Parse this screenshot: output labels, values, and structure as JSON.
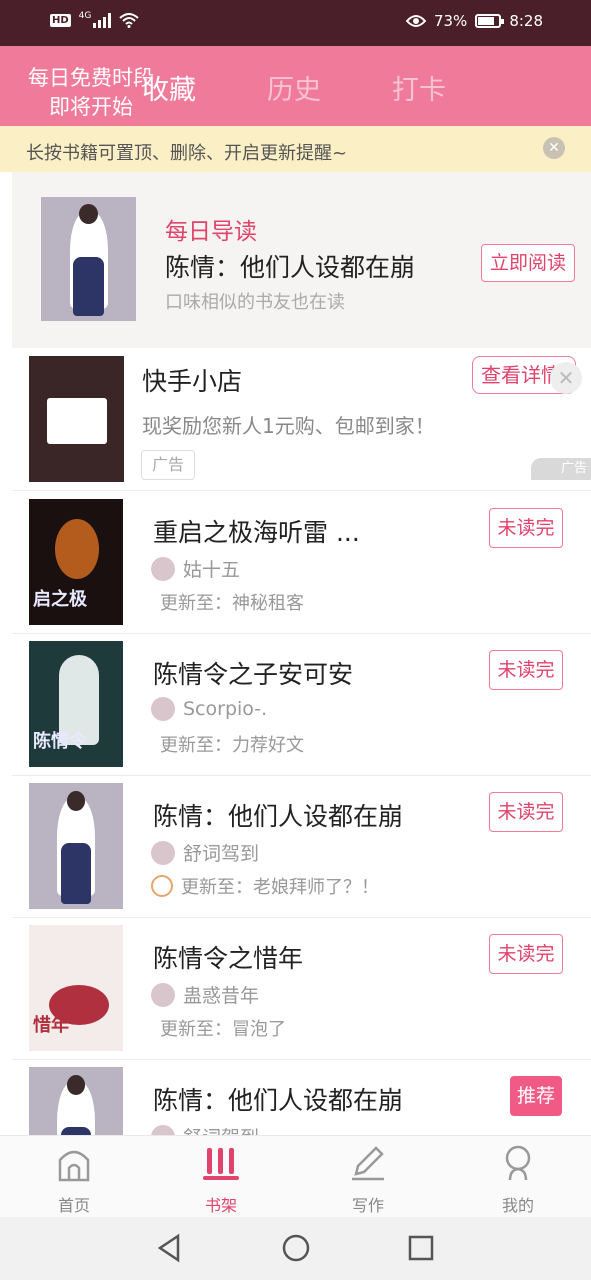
{
  "status_bar": {
    "network_badge": "HD",
    "network_type": "4G",
    "battery_percent": "73%",
    "time": "8:28",
    "icons": [
      "signal-icon",
      "wifi-icon",
      "eye-icon",
      "battery-icon"
    ]
  },
  "header": {
    "promo_line1": "每日免费时段",
    "promo_line2": "即将开始",
    "tabs": [
      {
        "label": "收藏",
        "active": true
      },
      {
        "label": "历史",
        "active": false
      },
      {
        "label": "打卡",
        "active": false
      }
    ]
  },
  "tip": {
    "text": "长按书籍可置顶、删除、开启更新提醒~"
  },
  "guide": {
    "label": "每日导读",
    "title": "陈情：他们人设都在崩",
    "subtitle": "口味相似的书友也在读",
    "button": "立即阅读"
  },
  "ad": {
    "title": "快手小店",
    "description": "现奖励您新人1元购、包邮到家！",
    "tag": "广告",
    "button": "查看详情",
    "corner": "广告"
  },
  "books": [
    {
      "title": "重启之极海听雷 ...",
      "author": "姑十五",
      "update": "更新至：神秘租客",
      "status": "未读完",
      "cover_text": "启之极"
    },
    {
      "title": "陈情令之子安可安",
      "author": "Scorpio-.",
      "update": "更新至：力荐好文",
      "status": "未读完",
      "cover_text": "陈情令"
    },
    {
      "title": "陈情：他们人设都在崩",
      "author": "舒词驾到",
      "update": "更新至：老娘拜师了？！",
      "status": "未读完",
      "cover_text": ""
    },
    {
      "title": "陈情令之惜年",
      "author": "蛊惑昔年",
      "update": "更新至：冒泡了",
      "status": "未读完",
      "cover_text": "惜年"
    },
    {
      "title": "陈情：他们人设都在崩",
      "author": "舒词驾到",
      "update": "",
      "status": "推荐",
      "cover_text": ""
    }
  ],
  "bottom_nav": [
    {
      "label": "首页",
      "icon": "home-icon",
      "active": false
    },
    {
      "label": "书架",
      "icon": "bookshelf-icon",
      "active": true
    },
    {
      "label": "写作",
      "icon": "pencil-icon",
      "active": false
    },
    {
      "label": "我的",
      "icon": "profile-icon",
      "active": false
    }
  ],
  "colors": {
    "accent": "#f07a99",
    "accent_dark": "#e0436b",
    "status_bar": "#4a1f2a",
    "tip_bg": "#fbefc6"
  }
}
